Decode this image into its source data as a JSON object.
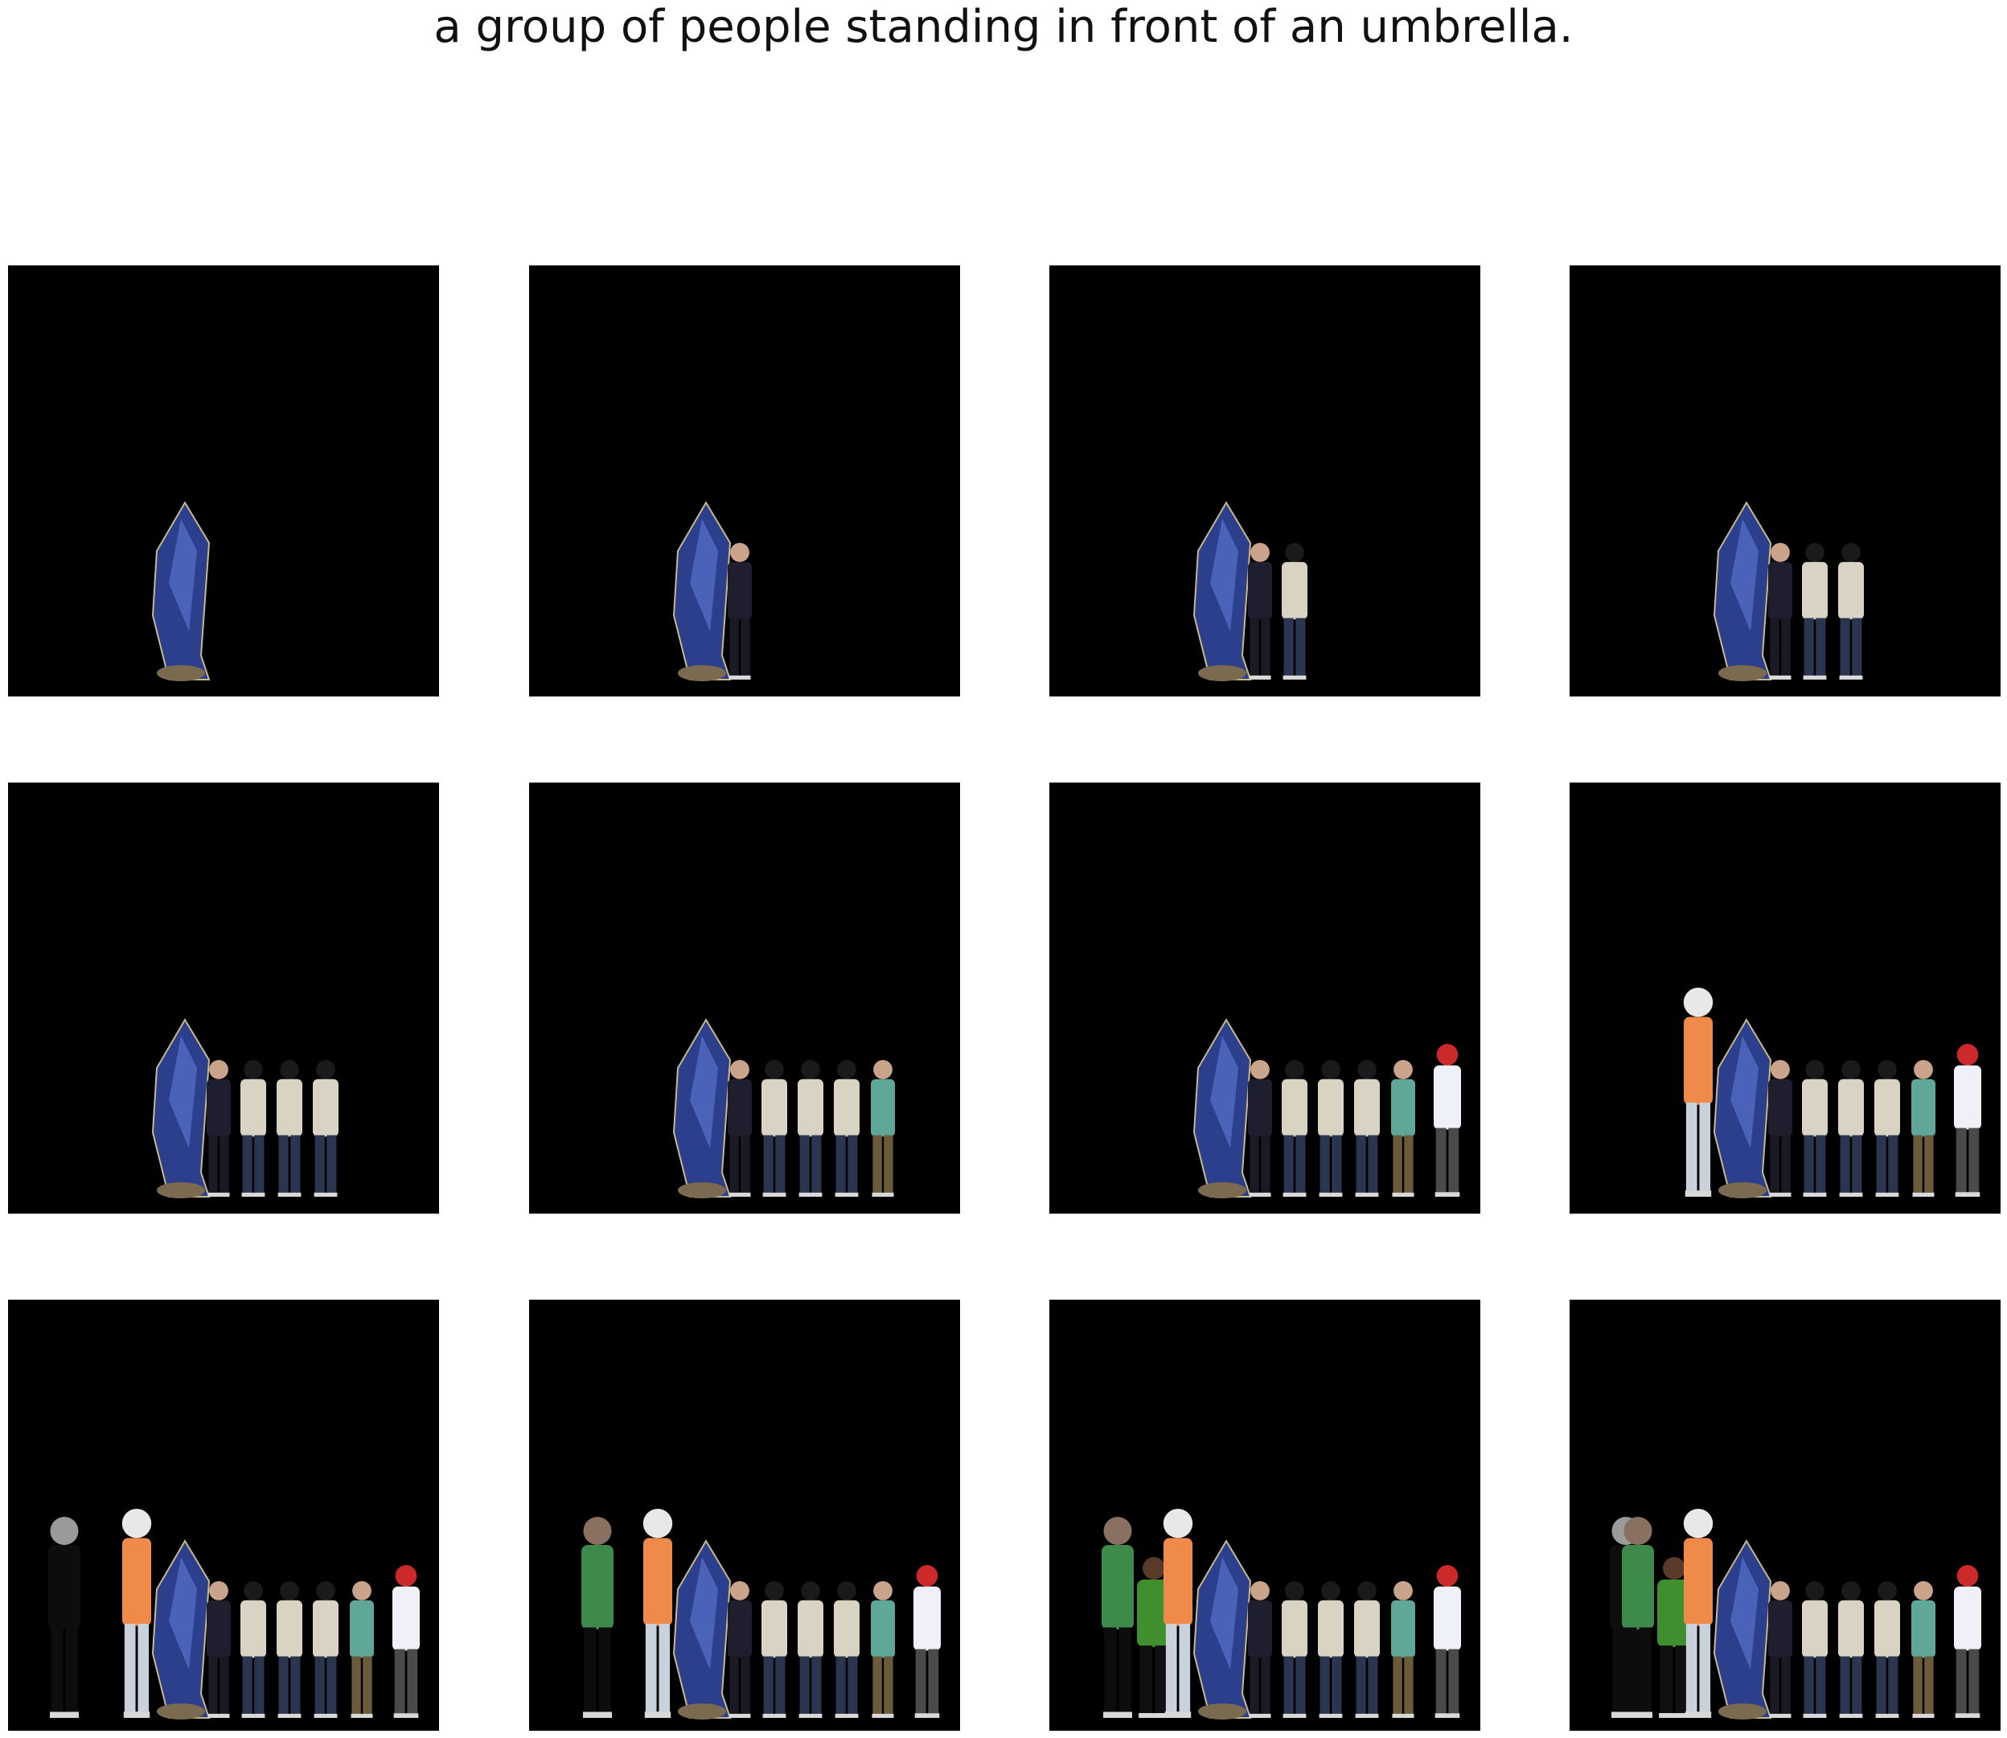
{
  "caption": "a group of people standing in front of an umbrella.",
  "grid": {
    "rows": 3,
    "columns": 4,
    "background_color": "#000000"
  },
  "figure_icon_names": [
    "blue-umbrella-figure",
    "black-jacket-person",
    "white-jacket-person",
    "white-jacket-person",
    "white-jacket-person",
    "teal-shirt-person",
    "red-cap-person",
    "orange-shirt-person",
    "black-suit-person",
    "green-shirt-person",
    "green-top-person"
  ]
}
